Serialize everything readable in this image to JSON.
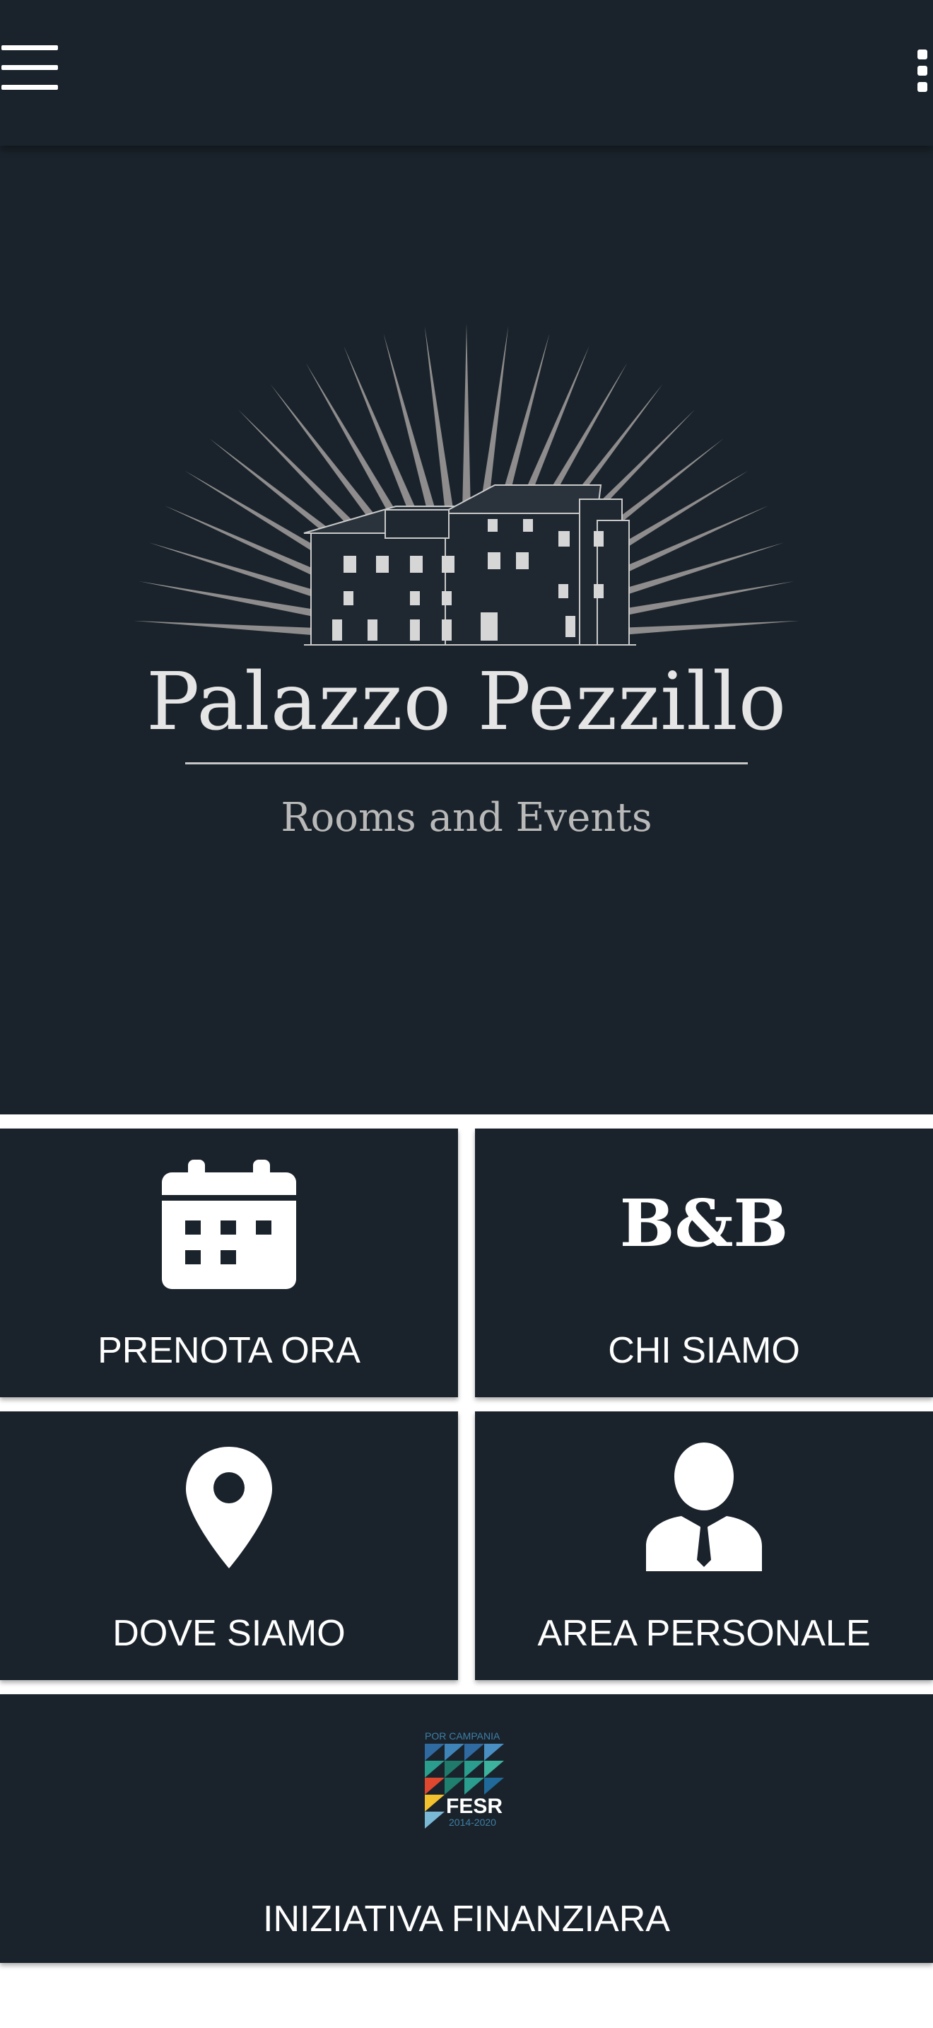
{
  "header": {
    "menu_icon": "hamburger-menu-icon",
    "more_icon": "more-vertical-icon"
  },
  "brand": {
    "name": "Palazzo Pezzillo",
    "tagline": "Rooms and Events",
    "logo": "palazzo-building-with-sunburst-logo"
  },
  "tiles": [
    {
      "icon": "calendar-icon",
      "label": "PRENOTA ORA"
    },
    {
      "icon": "bnb-text-icon",
      "glyph": "B&B",
      "label": "CHI SIAMO"
    },
    {
      "icon": "location-pin-icon",
      "label": "DOVE SIAMO"
    },
    {
      "icon": "person-suit-icon",
      "label": "AREA PERSONALE"
    }
  ],
  "financing": {
    "label": "INIZIATIVA FINANZIARA",
    "logo_lines": [
      "POR CAMPANIA",
      "FESR",
      "2014-2020"
    ]
  },
  "colors": {
    "background": "#1a232b",
    "divider": "#ffffff",
    "text": "#ffffff",
    "logo_rays": "#8e8c8c"
  }
}
